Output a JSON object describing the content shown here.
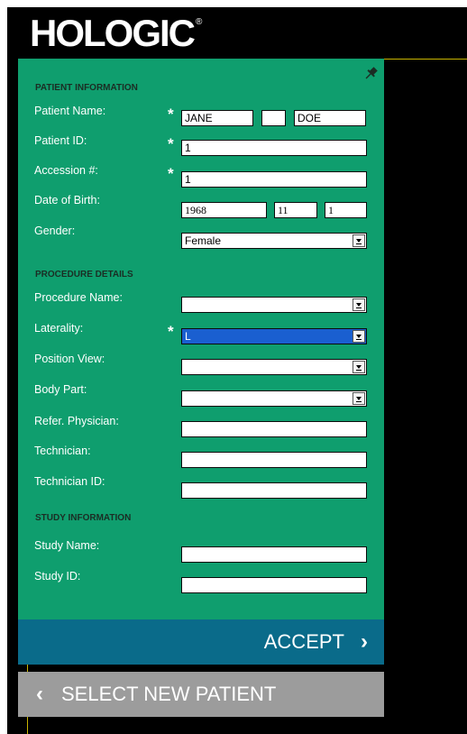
{
  "brand": {
    "logo_text": "HOLOGIC",
    "registered": "®"
  },
  "sections": {
    "patient": "PATIENT INFORMATION",
    "procedure": "PROCEDURE DETAILS",
    "study": "STUDY INFORMATION"
  },
  "labels": {
    "patient_name": "Patient Name:",
    "patient_id": "Patient ID:",
    "accession": "Accession #:",
    "dob": "Date of Birth:",
    "gender": "Gender:",
    "procedure_name": "Procedure Name:",
    "laterality": "Laterality:",
    "position_view": "Position View:",
    "body_part": "Body Part:",
    "refer_physician": "Refer. Physician:",
    "technician": "Technician:",
    "technician_id": "Technician ID:",
    "study_name": "Study Name:",
    "study_id": "Study ID:"
  },
  "required_mark": "*",
  "values": {
    "first_name": "JANE",
    "middle_name": "",
    "last_name": "DOE",
    "patient_id": "1",
    "accession": "1",
    "dob_year": "1968",
    "dob_month": "11",
    "dob_day": "1",
    "gender": "Female",
    "procedure_name": "",
    "laterality": "L",
    "position_view": "",
    "body_part": "",
    "refer_physician": "",
    "technician": "",
    "technician_id": "",
    "study_name": "",
    "study_id": ""
  },
  "buttons": {
    "accept": "ACCEPT",
    "accept_icon": "›",
    "select_new_patient": "SELECT NEW PATIENT",
    "back_icon": "‹"
  },
  "icons": {
    "pin": "pin-icon",
    "accept_chevron": "chevron-right-icon",
    "back_chevron": "chevron-left-icon",
    "dropdown": "dropdown-arrow-icon"
  },
  "colors": {
    "panel": "#0f9e6e",
    "accept_button": "#0a6b8a",
    "select_new_patient_button": "#9c9c9c",
    "selection_highlight": "#1a5fd0",
    "guide_line": "#c8b400"
  }
}
